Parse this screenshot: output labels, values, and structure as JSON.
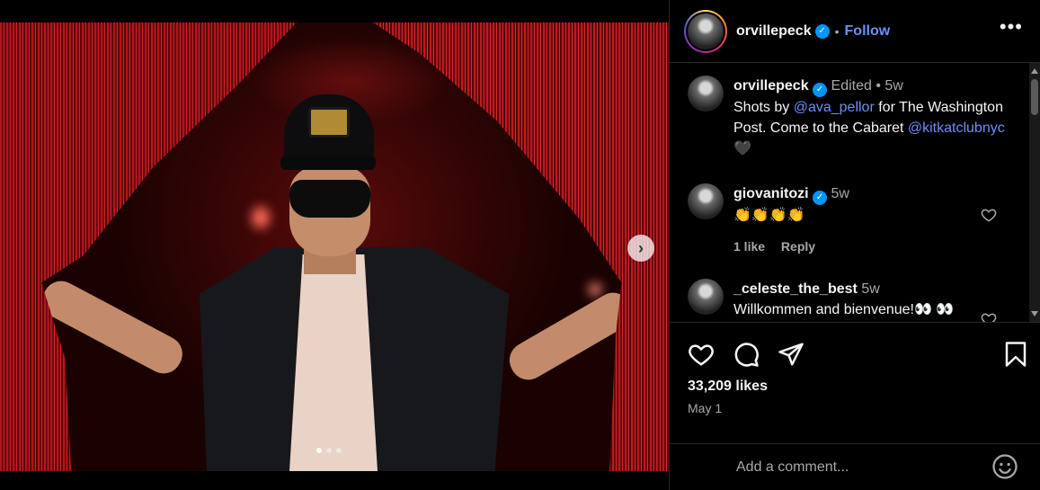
{
  "post": {
    "username": "orvillepeck",
    "follow_label": "Follow",
    "more_label": "•••",
    "carousel": {
      "total": 3,
      "active": 1,
      "next_label": "›"
    }
  },
  "caption": {
    "username": "orvillepeck",
    "edited": "Edited",
    "time": "5w",
    "text_parts": [
      "Shots by ",
      "@ava_pellor",
      " for The Washington Post. Come to the Cabaret ",
      "@kitkatclubnyc",
      " 🖤"
    ]
  },
  "comments": [
    {
      "username": "giovanitozi",
      "verified": true,
      "time": "5w",
      "text": "👏👏👏👏",
      "likes": "1 like",
      "reply": "Reply"
    },
    {
      "username": "_celeste_the_best",
      "verified": false,
      "time": "5w",
      "text": "Willkommen and bienvenue!👀 👀"
    }
  ],
  "actions": {
    "like_icon": "heart-icon",
    "comment_icon": "comment-icon",
    "share_icon": "paper-plane-icon",
    "save_icon": "bookmark-icon"
  },
  "likes": "33,209 likes",
  "date": "May 1",
  "comment_input": {
    "placeholder": "Add a comment..."
  },
  "colors": {
    "accent": "#0095f6",
    "link": "#6d8ff5",
    "curtain": "#b5141a"
  }
}
